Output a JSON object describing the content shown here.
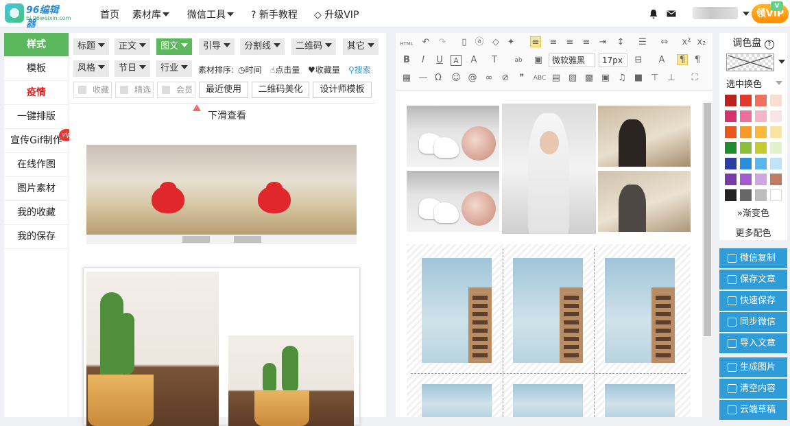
{
  "brand": {
    "title": "96编辑器",
    "subtitle": "bj.96weixin.com"
  },
  "nav": {
    "home": "首页",
    "materials": "素材库",
    "wechat_tools": "微信工具",
    "tutorial": "新手教程",
    "upgrade": "升级VIP"
  },
  "header": {
    "vip_badge": "领VIP",
    "vip_tag": "V"
  },
  "sidebar": {
    "items": [
      {
        "label": "样式"
      },
      {
        "label": "模板"
      },
      {
        "label": "疫情"
      },
      {
        "label": "一键排版"
      },
      {
        "label": "宣传Gif制作"
      },
      {
        "label": "在线作图"
      },
      {
        "label": "图片素材"
      },
      {
        "label": "我的收藏"
      },
      {
        "label": "我的保存"
      }
    ],
    "vip_flag": "vip"
  },
  "filters": {
    "row1": [
      "标题",
      "正文",
      "图文",
      "引导",
      "分割线",
      "二维码",
      "其它"
    ],
    "row2": [
      "风格",
      "节日",
      "行业"
    ],
    "sort_label": "素材排序:",
    "sort_time": "时间",
    "sort_clicks": "点击量",
    "sort_favs": "收藏量",
    "search": "搜索",
    "check_fav": "收藏",
    "check_pick": "精选",
    "check_member": "会员",
    "btn_recent": "最近使用",
    "btn_qr": "二维码美化",
    "btn_designer": "设计师模板"
  },
  "materials": {
    "scroll_hint": "下滑查看"
  },
  "editor": {
    "font_family": "微软雅黑",
    "font_size": "17px",
    "html_label": "HTML"
  },
  "palette": {
    "title": "调色盘",
    "subtitle": "选中换色",
    "gradient": "渐变色",
    "more": "更多配色",
    "colors": [
      "#b9221d",
      "#e3382e",
      "#f0705f",
      "#f9ddd3",
      "#d6316b",
      "#ef6f98",
      "#f5b5c8",
      "#fbe3ea",
      "#e9561e",
      "#f79a2b",
      "#f9b73b",
      "#fbe3a0",
      "#1d8c2f",
      "#8abf3a",
      "#c4cb2d",
      "#e2f0cb",
      "#2a3ea6",
      "#2a8fd8",
      "#5ab7ee",
      "#bfe3f7",
      "#7b3aa8",
      "#a55bd0",
      "#cfa5e5",
      "#c07b62",
      "#222222",
      "#666666",
      "#bdbdbd",
      "#ffffff"
    ]
  },
  "actions": [
    "微信复制",
    "保存文章",
    "快速保存",
    "同步微信",
    "导入文章",
    "生成图片",
    "清空内容",
    "云端草稿"
  ]
}
